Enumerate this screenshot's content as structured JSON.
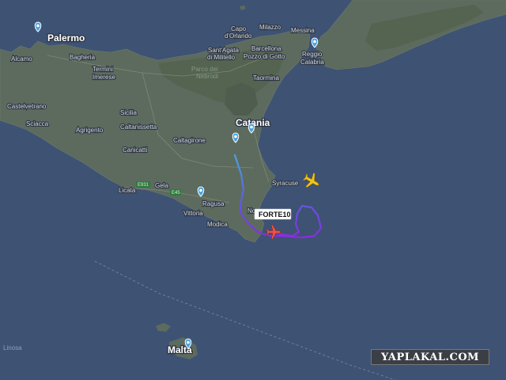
{
  "map": {
    "colors": {
      "sea": "#3e5274",
      "land": "#5c6b5e",
      "land_dark": "#4f5e52",
      "track_start": "#4aa3e0",
      "track_end": "#8b2be2",
      "selected_plane": "#e8524a",
      "other_plane": "#f2c21b",
      "airport_pin": "#4aa3e0"
    },
    "places": {
      "palermo": "Palermo",
      "alcamo": "Alcamo",
      "bagheria": "Bagheria",
      "termini": "Termini",
      "imerese": "Imerese",
      "capo": "Capo",
      "dorlando": "d'Orlando",
      "milazzo": "Milazzo",
      "messina": "Messina",
      "santagata": "Sant'Agata",
      "dimilitello": "di Militello",
      "barcellona": "Barcellona",
      "pozzodigotto": "Pozzo di Gotto",
      "reggio": "Reggio",
      "calabria": "Calabria",
      "parco": "Parco dei",
      "nebrodi": "Nebrodi",
      "taormina": "Taormina",
      "castelvetrano": "Castelvetrano",
      "sicilia": "Sicilia",
      "caltanissetta": "Caltanissetta",
      "catania": "Catania",
      "sciacca": "Sciacca",
      "agrigento": "Agrigento",
      "canicatti": "Canicatti",
      "caltagirone": "Caltagirone",
      "licata": "Licata",
      "gela": "Gela",
      "syracuse": "Syracuse",
      "ragusa": "Ragusa",
      "vittoria": "Vittoria",
      "modica": "Modica",
      "noto": "No",
      "malta": "Malta",
      "linosa": "Linosa"
    },
    "road_badges": [
      "E931",
      "E45"
    ],
    "flight": {
      "callsign": "FORTE10"
    }
  },
  "watermark": "YAPLAKAL.COM"
}
